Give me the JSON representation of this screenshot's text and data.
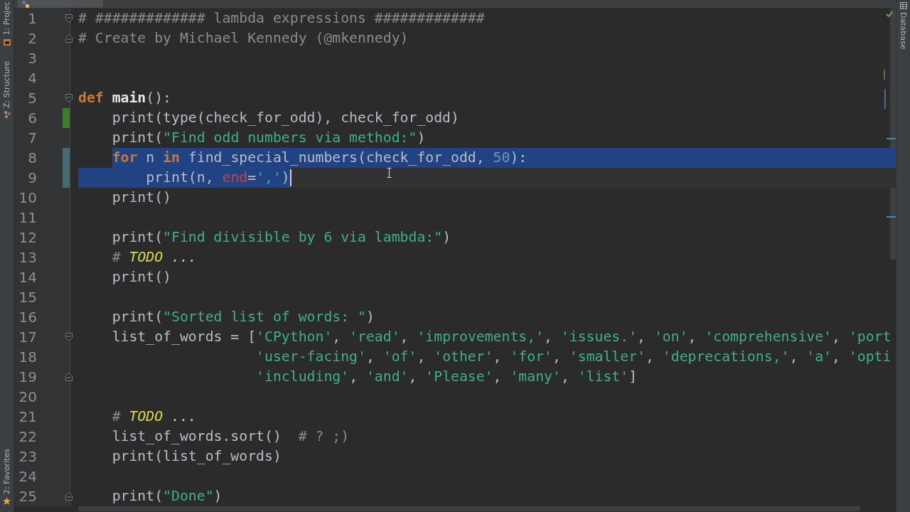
{
  "left_toolbar": [
    {
      "label": "1: Projec",
      "kind": "project"
    },
    {
      "label": "Z: Structure",
      "kind": "structure"
    },
    {
      "label": "2: Favorites",
      "kind": "favorites"
    }
  ],
  "right_toolbar": [
    {
      "label": "Database",
      "kind": "database"
    }
  ],
  "editor": {
    "lines": [
      {
        "number": "1",
        "fold_start": true,
        "tokens": [
          {
            "kind": "comment",
            "text": "# ############# lambda expressions #############"
          }
        ]
      },
      {
        "number": "2",
        "fold_end": true,
        "tokens": [
          {
            "kind": "comment",
            "text": "# Create by Michael Kennedy (@mkennedy)"
          }
        ]
      },
      {
        "number": "3"
      },
      {
        "number": "4"
      },
      {
        "number": "5",
        "fold_start": true,
        "tokens": [
          {
            "kind": "kw",
            "text": "def"
          },
          {
            "kind": "fndef",
            "text": " main"
          },
          {
            "kind": "plain",
            "text": "():"
          }
        ]
      },
      {
        "number": "6",
        "added": true,
        "tokens": [
          {
            "kind": "plain",
            "text": "    print(type(check_for_odd), check_for_odd)"
          }
        ]
      },
      {
        "number": "7",
        "tokens": [
          {
            "kind": "plain",
            "text": "    print("
          },
          {
            "kind": "str",
            "text": "\"Find odd numbers via method:\""
          },
          {
            "kind": "plain",
            "text": ")"
          }
        ]
      },
      {
        "number": "8",
        "modified": true,
        "selected": true,
        "tokens": [
          {
            "kind": "kw",
            "text": "    for"
          },
          {
            "kind": "plain",
            "text": " n "
          },
          {
            "kind": "kw",
            "text": "in"
          },
          {
            "kind": "plain",
            "text": " find_special_numbers(check_for_odd, "
          },
          {
            "kind": "num",
            "text": "50"
          },
          {
            "kind": "plain",
            "text": "):"
          }
        ]
      },
      {
        "number": "9",
        "modified": true,
        "selected": true,
        "caret": true,
        "tokens": [
          {
            "kind": "plain",
            "text": "        print(n, "
          },
          {
            "kind": "param",
            "text": "end"
          },
          {
            "kind": "plain",
            "text": "="
          },
          {
            "kind": "str",
            "text": "','"
          },
          {
            "kind": "plain",
            "text": ")"
          }
        ]
      },
      {
        "number": "10",
        "tokens": [
          {
            "kind": "plain",
            "text": "    print()"
          }
        ]
      },
      {
        "number": "11"
      },
      {
        "number": "12",
        "tokens": [
          {
            "kind": "plain",
            "text": "    print("
          },
          {
            "kind": "str",
            "text": "\"Find divisible by 6 via lambda:\""
          },
          {
            "kind": "plain",
            "text": ")"
          }
        ]
      },
      {
        "number": "13",
        "tokens": [
          {
            "kind": "comment",
            "text": "    # "
          },
          {
            "kind": "todo",
            "text": "TODO ..."
          }
        ]
      },
      {
        "number": "14",
        "tokens": [
          {
            "kind": "plain",
            "text": "    print()"
          }
        ]
      },
      {
        "number": "15"
      },
      {
        "number": "16",
        "tokens": [
          {
            "kind": "plain",
            "text": "    print("
          },
          {
            "kind": "str",
            "text": "\"Sorted list of words: \""
          },
          {
            "kind": "plain",
            "text": ")"
          }
        ]
      },
      {
        "number": "17",
        "fold_start": true,
        "tokens": [
          {
            "kind": "plain",
            "text": "    list_of_words = ["
          },
          {
            "kind": "str",
            "text": "'CPython'"
          },
          {
            "kind": "plain",
            "text": ", "
          },
          {
            "kind": "str",
            "text": "'read'"
          },
          {
            "kind": "plain",
            "text": ", "
          },
          {
            "kind": "str",
            "text": "'improvements,'"
          },
          {
            "kind": "plain",
            "text": ", "
          },
          {
            "kind": "str",
            "text": "'issues.'"
          },
          {
            "kind": "plain",
            "text": ", "
          },
          {
            "kind": "str",
            "text": "'on'"
          },
          {
            "kind": "plain",
            "text": ", "
          },
          {
            "kind": "str",
            "text": "'comprehensive'"
          },
          {
            "kind": "plain",
            "text": ", "
          },
          {
            "kind": "str",
            "text": "'port"
          }
        ]
      },
      {
        "number": "18",
        "tokens": [
          {
            "kind": "str",
            "text": "                     'user-facing'"
          },
          {
            "kind": "plain",
            "text": ", "
          },
          {
            "kind": "str",
            "text": "'of'"
          },
          {
            "kind": "plain",
            "text": ", "
          },
          {
            "kind": "str",
            "text": "'other'"
          },
          {
            "kind": "plain",
            "text": ", "
          },
          {
            "kind": "str",
            "text": "'for'"
          },
          {
            "kind": "plain",
            "text": ", "
          },
          {
            "kind": "str",
            "text": "'smaller'"
          },
          {
            "kind": "plain",
            "text": ", "
          },
          {
            "kind": "str",
            "text": "'deprecations,'"
          },
          {
            "kind": "plain",
            "text": ", "
          },
          {
            "kind": "str",
            "text": "'a'"
          },
          {
            "kind": "plain",
            "text": ", "
          },
          {
            "kind": "str",
            "text": "'opti"
          }
        ]
      },
      {
        "number": "19",
        "fold_end": true,
        "tokens": [
          {
            "kind": "str",
            "text": "                     'including'"
          },
          {
            "kind": "plain",
            "text": ", "
          },
          {
            "kind": "str",
            "text": "'and'"
          },
          {
            "kind": "plain",
            "text": ", "
          },
          {
            "kind": "str",
            "text": "'Please'"
          },
          {
            "kind": "plain",
            "text": ", "
          },
          {
            "kind": "str",
            "text": "'many'"
          },
          {
            "kind": "plain",
            "text": ", "
          },
          {
            "kind": "str",
            "text": "'list'"
          },
          {
            "kind": "plain",
            "text": "]"
          }
        ]
      },
      {
        "number": "20"
      },
      {
        "number": "21",
        "tokens": [
          {
            "kind": "comment",
            "text": "    # "
          },
          {
            "kind": "todo",
            "text": "TODO ..."
          }
        ]
      },
      {
        "number": "22",
        "tokens": [
          {
            "kind": "plain",
            "text": "    list_of_words.sort()  "
          },
          {
            "kind": "comment",
            "text": "# ? ;)"
          }
        ]
      },
      {
        "number": "23",
        "tokens": [
          {
            "kind": "plain",
            "text": "    print(list_of_words)"
          }
        ]
      },
      {
        "number": "24"
      },
      {
        "number": "25",
        "fold_end": true,
        "tokens": [
          {
            "kind": "plain",
            "text": "    print("
          },
          {
            "kind": "str",
            "text": "\"Done\""
          },
          {
            "kind": "plain",
            "text": ")"
          }
        ]
      }
    ]
  }
}
